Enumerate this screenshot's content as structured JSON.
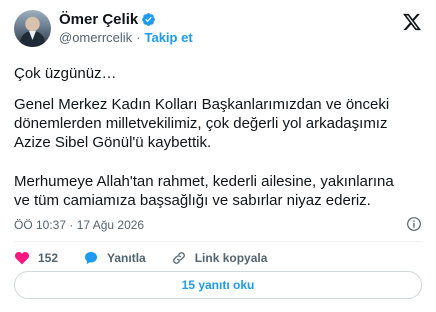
{
  "author": {
    "name": "Ömer Çelik",
    "handle": "@omerrcelik",
    "follow_label": "Takip et"
  },
  "tweet": {
    "p1": "Çok üzgünüz…",
    "p2": "Genel Merkez Kadın Kolları Başkanlarımızdan ve önceki\ndönemlerden milletvekilimiz, çok değerli yol arkadaşımız\nAzize Sibel Gönül'ü kaybettik.",
    "p3": "Merhumeye Allah'tan rahmet, kederli ailesine, yakınlarına\nve tüm camiamıza başsağlığı ve sabırlar niyaz ederiz.",
    "timestamp": "ÖÖ 10:37 · 17 Ağu 2026"
  },
  "actions": {
    "like_count": "152",
    "reply_label": "Yanıtla",
    "copy_link_label": "Link kopyala"
  },
  "read_replies_label": "15 yanıtı oku",
  "colors": {
    "accent": "#1d9bf0",
    "like": "#f91880",
    "muted": "#536471"
  },
  "icons": [
    "avatar",
    "verified-icon",
    "x-logo-icon",
    "info-icon",
    "heart-icon",
    "reply-icon",
    "link-icon"
  ]
}
